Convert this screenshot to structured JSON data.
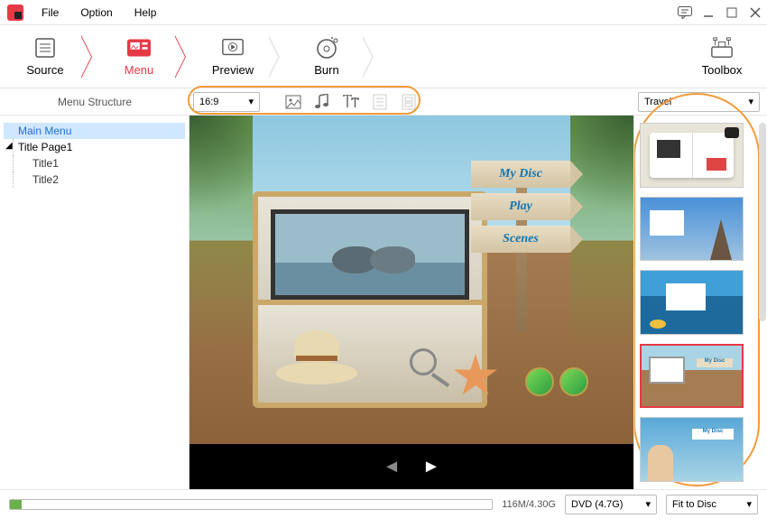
{
  "menubar": {
    "file": "File",
    "option": "Option",
    "help": "Help"
  },
  "workflow": {
    "source": "Source",
    "menu": "Menu",
    "preview": "Preview",
    "burn": "Burn",
    "toolbox": "Toolbox"
  },
  "toolbar": {
    "left_label": "Menu Structure",
    "aspect_ratio": "16:9",
    "category": "Travel"
  },
  "tree": {
    "main_menu": "Main Menu",
    "title_page": "Title Page1",
    "title1": "Title1",
    "title2": "Title2"
  },
  "disc_menu": {
    "title": "My Disc",
    "play": "Play",
    "scenes": "Scenes"
  },
  "tpl_labels": {
    "mydisc": "My Disc"
  },
  "status": {
    "disc_usage": "116M/4.30G",
    "disc_type": "DVD (4.7G)",
    "fit": "Fit to Disc"
  }
}
